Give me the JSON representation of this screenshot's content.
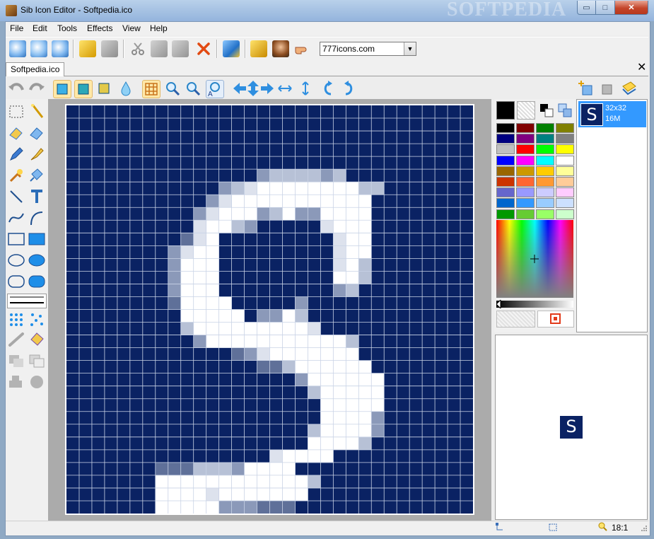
{
  "window": {
    "title": "Sib Icon Editor - Softpedia.ico",
    "watermark": "SOFTPEDIA",
    "controls": {
      "minimize": "▭",
      "maximize": "□",
      "close": "✕"
    }
  },
  "menu": [
    "File",
    "Edit",
    "Tools",
    "Effects",
    "View",
    "Help"
  ],
  "toolbar": {
    "icon_source": {
      "value": "777icons.com",
      "arrow": "▼"
    }
  },
  "document_tab": {
    "label": "Softpedia.ico",
    "close": "✕"
  },
  "formats": [
    {
      "thumb_letter": "S",
      "size": "32x32",
      "depth": "16M",
      "selected": true
    }
  ],
  "preview": {
    "letter": "S"
  },
  "status": {
    "zoom": "18:1"
  },
  "palette": {
    "swatches": [
      "#000000",
      "#800000",
      "#008000",
      "#808000",
      "#000080",
      "#800080",
      "#008080",
      "#808080",
      "#c0c0c0",
      "#ff0000",
      "#00ff00",
      "#ffff00",
      "#0000ff",
      "#ff00ff",
      "#00ffff",
      "#ffffff",
      "#996600",
      "#cc9900",
      "#ffcc00",
      "#ffff99",
      "#cc3300",
      "#ff6633",
      "#ff9933",
      "#ffcc99",
      "#6666cc",
      "#9999ff",
      "#ccccff",
      "#ffccff",
      "#0066cc",
      "#3399ff",
      "#99ccff",
      "#cce0ff",
      "#009900",
      "#66cc33",
      "#99ff66",
      "#ccffcc"
    ]
  },
  "icon": {
    "grid_size": 32,
    "background": "#0a2263",
    "palette": {
      "1": "#ffffff",
      "2": "#dde2ed",
      "3": "#b7c1d6",
      "4": "#8b99b9",
      "5": "#5f7099"
    },
    "rows": [
      "................................",
      "................................",
      "................................",
      "................................",
      "................................",
      "...............4333343..........",
      "............4321111111133........",
      "...........4211111111111........",
      "..........42111431441111........",
      "..........21134.....2111........",
      ".........521.........211........",
      "........4211.........211........",
      "........4111.........213........",
      "........4111.........113........",
      "........4111.........43.........",
      "........51111.....4.............",
      ".........11111.4413.............",
      ".........31111111112............",
      "..........4111111111113.........",
      ".............5421111111.........",
      "...............553111111........",
      "..................4111111.......",
      "...................311111.......",
      "....................11111.......",
      "....................11114.......",
      "...................311114.......",
      "...................11113........",
      "................21111...........",
      ".......55533341111..............",
      ".......1111111111113............",
      ".......111121111111.............",
      ".......11111444555..............",
      "................................"
    ]
  }
}
